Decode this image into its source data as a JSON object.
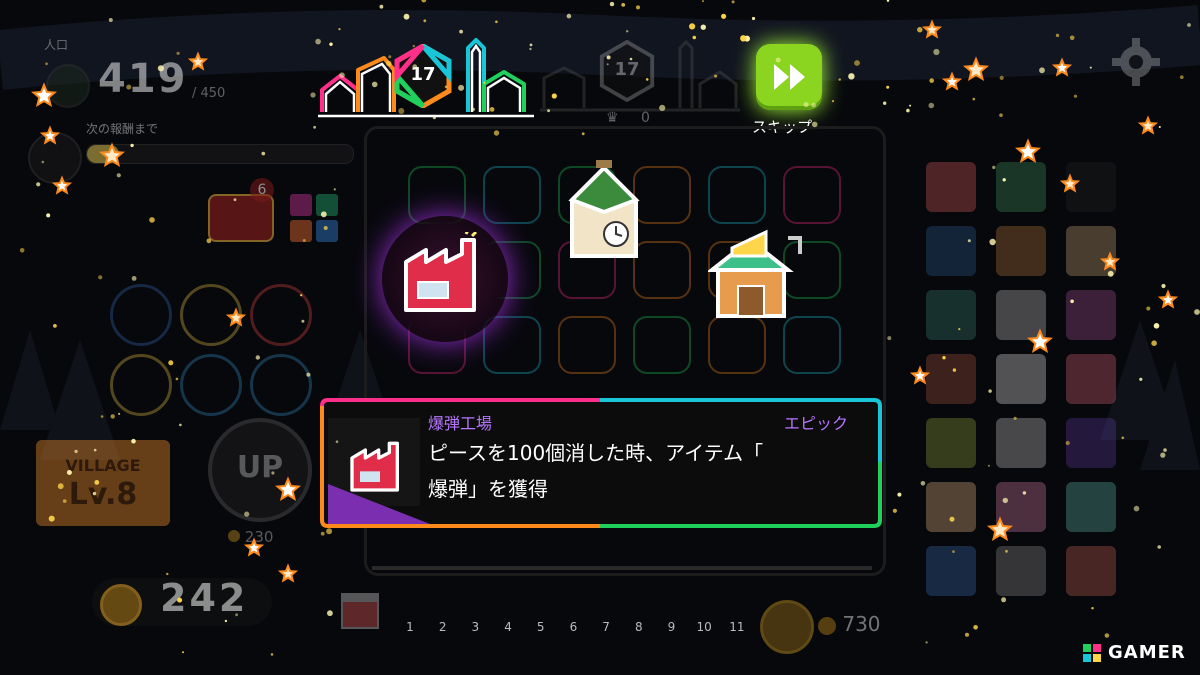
{
  "hud": {
    "population_label": "人口",
    "population_value": "419",
    "population_max": "/ 450",
    "reward_label": "次の報酬まで",
    "badge_count": "6",
    "village_title": "VILLAGE",
    "village_level": "Lv.8",
    "up_label": "UP",
    "up_cost": "230",
    "coins": "242",
    "right_coins": "730",
    "crown_count": "0"
  },
  "header": {
    "round_badge": "17",
    "round_badge_dim": "17"
  },
  "skip": {
    "label": "スキップ"
  },
  "tooltip": {
    "name": "爆弾工場",
    "rarity": "エピック",
    "desc_line1": "ピースを100個消した時、アイテム「",
    "desc_line2": "爆弾」を獲得"
  },
  "timeline": {
    "ticks": [
      "1",
      "2",
      "3",
      "4",
      "5",
      "6",
      "7",
      "8",
      "9",
      "10",
      "11"
    ]
  },
  "watermark": "GAMER",
  "colors": {
    "skip_green": "#8bd420",
    "rarity_purple": "#b776ff",
    "factory_red": "#e02d4a",
    "border_cyan": "#19c6d8",
    "border_pink": "#ff2f8a",
    "border_green": "#1fd15c",
    "border_orange": "#ff8a1c"
  },
  "icons": [
    "factory-icon",
    "clock-tower-icon",
    "cheese-shop-icon",
    "gear-icon",
    "skip-icon",
    "crown-icon",
    "coin-icon",
    "treasure-chest-icon",
    "star-icon"
  ]
}
